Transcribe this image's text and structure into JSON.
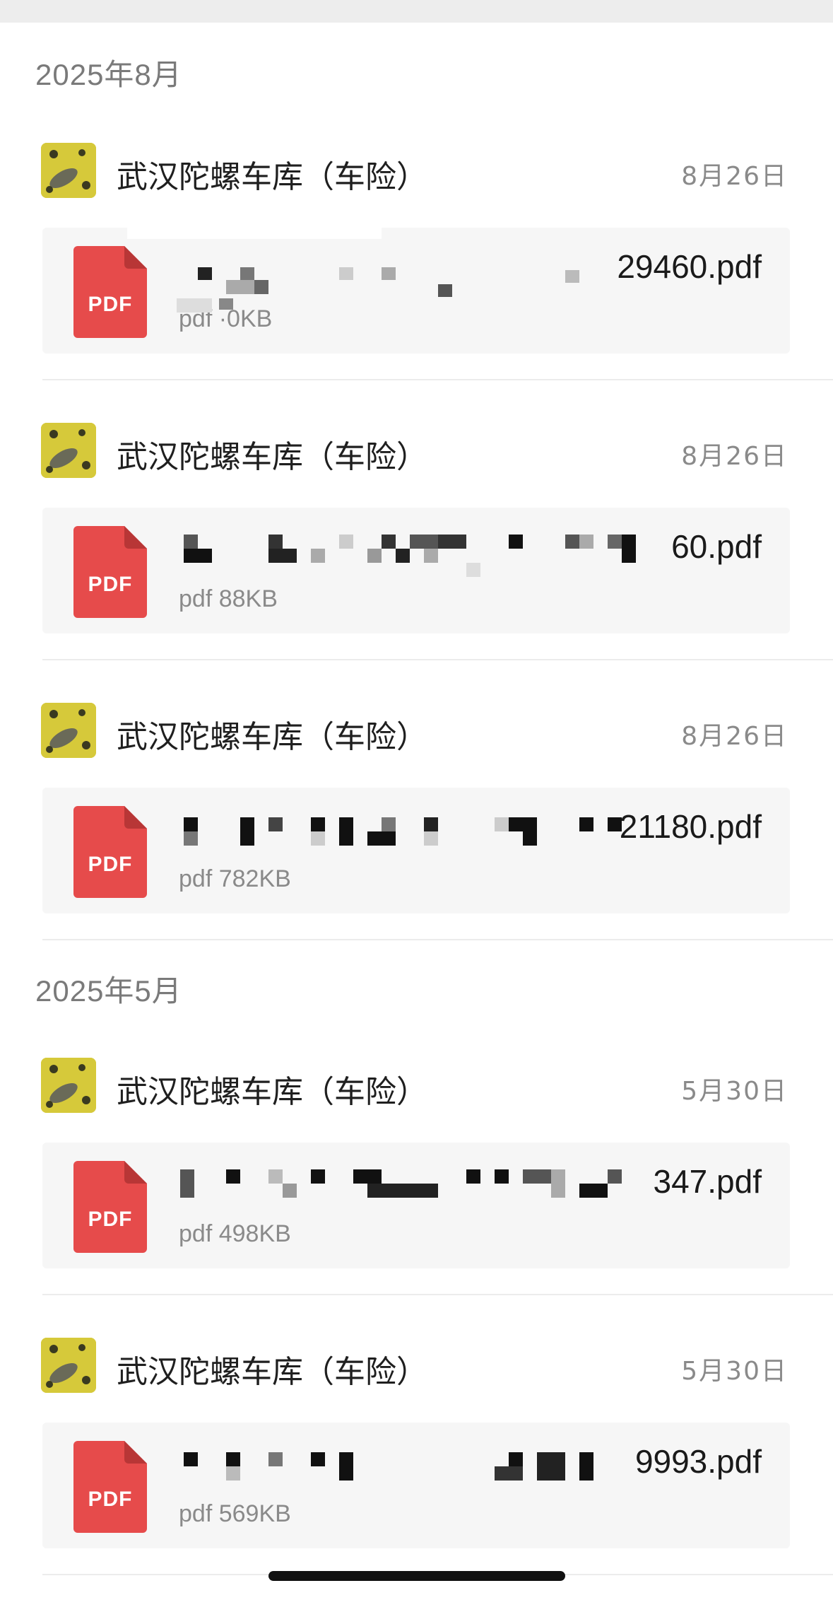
{
  "sections": [
    {
      "title": "2025年8月",
      "messages": [
        {
          "sender": "武汉陀螺车库（车险）",
          "date": "8月26日",
          "file": {
            "name_visible": "29460.pdf",
            "size": "pdf  ·0KB",
            "icon": "PDF"
          }
        },
        {
          "sender": "武汉陀螺车库（车险）",
          "date": "8月26日",
          "file": {
            "name_visible": "60.pdf",
            "size": "pdf 88KB",
            "icon": "PDF"
          }
        },
        {
          "sender": "武汉陀螺车库（车险）",
          "date": "8月26日",
          "file": {
            "name_visible": "21180.pdf",
            "size": "pdf 782KB",
            "icon": "PDF"
          }
        }
      ]
    },
    {
      "title": "2025年5月",
      "messages": [
        {
          "sender": "武汉陀螺车库（车险）",
          "date": "5月30日",
          "file": {
            "name_visible": "347.pdf",
            "size": "pdf 498KB",
            "icon": "PDF"
          }
        },
        {
          "sender": "武汉陀螺车库（车险）",
          "date": "5月30日",
          "file": {
            "name_visible": "9993.pdf",
            "size": "pdf 569KB",
            "icon": "PDF"
          }
        }
      ]
    }
  ],
  "colors": {
    "pdf_red": "#e64b4b",
    "card_bg": "#f6f6f6",
    "muted_text": "#8a8a8a"
  },
  "icons": {
    "avatar": "avatar-image",
    "file": "pdf-file-icon"
  }
}
